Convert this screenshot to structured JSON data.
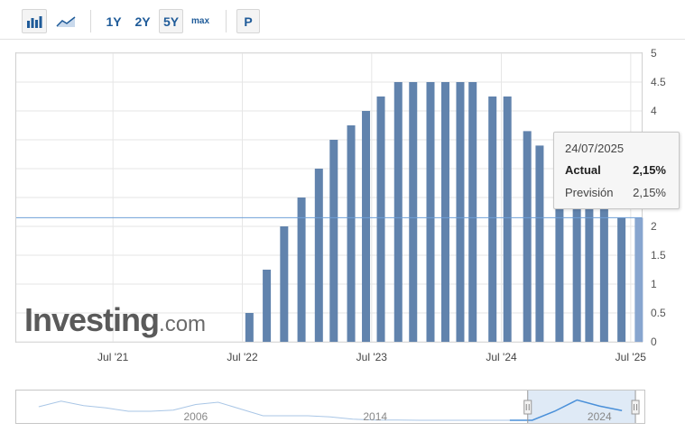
{
  "toolbar": {
    "icons": [
      "bar-chart-icon",
      "area-chart-icon"
    ],
    "ranges": [
      "1Y",
      "2Y",
      "5Y",
      "max"
    ],
    "selected_range": "5Y",
    "extra_button": "P"
  },
  "colors": {
    "bars": "#6183ad",
    "highlight_bar": "#87a5cf",
    "reference_line": "#6fa0d8",
    "navigator_line": "#4a90d9",
    "navigator_fill": "#dfeaf6"
  },
  "chart_data": {
    "type": "bar",
    "series": [
      {
        "name": "Actual",
        "dates": [
          "2022-07-21",
          "2022-09-08",
          "2022-10-27",
          "2022-12-15",
          "2023-02-02",
          "2023-03-16",
          "2023-05-04",
          "2023-06-15",
          "2023-07-27",
          "2023-09-14",
          "2023-10-26",
          "2023-12-14",
          "2024-01-25",
          "2024-03-07",
          "2024-04-11",
          "2024-06-06",
          "2024-07-18",
          "2024-09-12",
          "2024-10-17",
          "2024-12-12",
          "2025-01-30",
          "2025-03-06",
          "2025-04-17",
          "2025-06-05",
          "2025-07-24"
        ],
        "values": [
          0.5,
          1.25,
          2.0,
          2.5,
          3.0,
          3.5,
          3.75,
          4.0,
          4.25,
          4.5,
          4.5,
          4.5,
          4.5,
          4.5,
          4.5,
          4.25,
          4.25,
          3.65,
          3.4,
          3.15,
          2.9,
          2.65,
          2.4,
          2.15,
          2.15
        ]
      }
    ],
    "reference_line": 2.15,
    "x_ticks": [
      "Jul '21",
      "Jul '22",
      "Jul '23",
      "Jul '24",
      "Jul '25"
    ],
    "x_tick_dates": [
      "2021-07-01",
      "2022-07-01",
      "2023-07-01",
      "2024-07-01",
      "2025-07-01"
    ],
    "xlim": [
      "2020-10-01",
      "2025-08-01"
    ],
    "y_ticks": [
      "0",
      "0.5",
      "1",
      "1.5",
      "2",
      "2.5",
      "3",
      "3.5",
      "4",
      "4.5",
      "5"
    ],
    "ylim": [
      0,
      5
    ],
    "grid": true,
    "tooltip": {
      "date": "24/07/2025",
      "actual_label": "Actual",
      "actual_value": "2,15%",
      "forecast_label": "Previsión",
      "forecast_value": "2,15%"
    }
  },
  "watermark": {
    "main": "Investing",
    "domain": ".com"
  },
  "navigator": {
    "labels": [
      "2006",
      "2014",
      "2024"
    ],
    "label_years": [
      2006,
      2014,
      2024
    ],
    "range_years": [
      1998,
      2026
    ],
    "profile_years": [
      1999,
      2000,
      2001,
      2002,
      2003,
      2004,
      2005,
      2006,
      2007,
      2008,
      2009,
      2010,
      2011,
      2012,
      2013,
      2014,
      2015,
      2016,
      2017,
      2018,
      2019,
      2020,
      2021,
      2022,
      2023,
      2024,
      2025
    ],
    "profile_values": [
      3.0,
      4.25,
      3.25,
      2.75,
      2.0,
      2.0,
      2.25,
      3.5,
      4.0,
      2.5,
      1.0,
      1.0,
      1.0,
      0.75,
      0.25,
      0.05,
      0.05,
      0.0,
      0.0,
      0.0,
      0.0,
      0.0,
      0.0,
      2.0,
      4.5,
      3.15,
      2.15
    ],
    "selected_range_years": [
      2020.8,
      2025.6
    ]
  }
}
